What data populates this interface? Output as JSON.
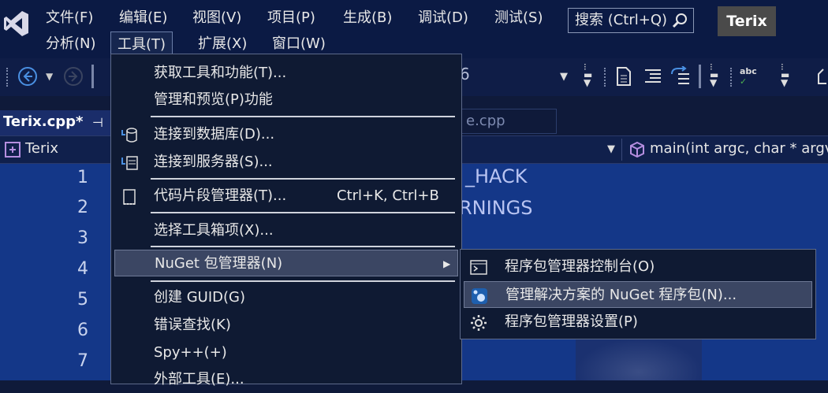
{
  "menubar": {
    "row1": [
      "文件(F)",
      "编辑(E)",
      "视图(V)",
      "项目(P)",
      "生成(B)",
      "调试(D)",
      "测试(S)"
    ],
    "row2": [
      "分析(N)",
      "工具(T)",
      "扩展(X)",
      "窗口(W)"
    ]
  },
  "search": {
    "label": "搜索 (Ctrl+Q)"
  },
  "account": {
    "label": "Terix"
  },
  "tabs": {
    "active": "Terix.cpp*",
    "inactive_partial": "e.cpp"
  },
  "navbar": {
    "scope": "Terix",
    "member": "main(int argc, char * argv"
  },
  "toolbar": {
    "partial_text": "6"
  },
  "editor": {
    "line_numbers": [
      "1",
      "2",
      "3",
      "4",
      "5",
      "6",
      "7"
    ],
    "visible_fragments": [
      "_HACK",
      "RNINGS"
    ]
  },
  "tools_menu": {
    "items": [
      {
        "label": "获取工具和功能(T)..."
      },
      {
        "label": "管理和预览(P)功能"
      },
      {
        "label": "连接到数据库(D)..."
      },
      {
        "label": "连接到服务器(S)..."
      },
      {
        "label": "代码片段管理器(T)...",
        "shortcut": "Ctrl+K, Ctrl+B"
      },
      {
        "label": "选择工具箱项(X)..."
      },
      {
        "label": "NuGet 包管理器(N)"
      },
      {
        "label": "创建 GUID(G)"
      },
      {
        "label": "错误查找(K)"
      },
      {
        "label": "Spy++(+)"
      },
      {
        "label": "外部工具(E)..."
      }
    ]
  },
  "nuget_menu": {
    "items": [
      {
        "label": "程序包管理器控制台(O)"
      },
      {
        "label": "管理解决方案的 NuGet 程序包(N)..."
      },
      {
        "label": "程序包管理器设置(P)"
      }
    ]
  },
  "colors": {
    "highlight": "#3b4663",
    "menu_bg": "#0f1a33",
    "editor_bg": "#143788"
  }
}
